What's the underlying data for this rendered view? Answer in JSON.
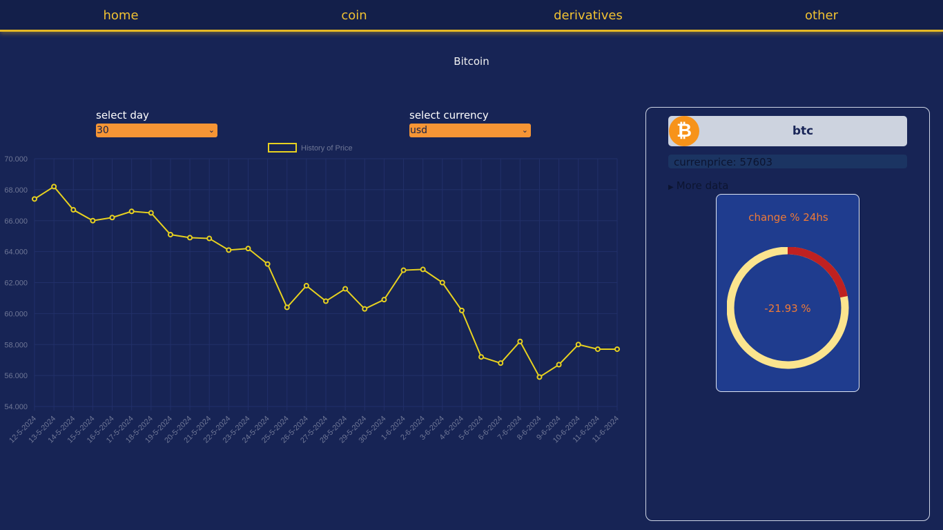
{
  "nav": {
    "items": [
      {
        "label": "home"
      },
      {
        "label": "coin"
      },
      {
        "label": "derivatives"
      },
      {
        "label": "other"
      }
    ]
  },
  "page": {
    "title": "Bitcoin"
  },
  "controls": {
    "day_label": "select day",
    "day_value": "30",
    "currency_label": "select currency",
    "currency_value": "usd"
  },
  "chart_data": {
    "type": "line",
    "x": [
      "12-5-2024",
      "13-5-2024",
      "14-5-2024",
      "15-5-2024",
      "16-5-2024",
      "17-5-2024",
      "18-5-2024",
      "19-5-2024",
      "20-5-2024",
      "21-5-2024",
      "22-5-2024",
      "23-5-2024",
      "24-5-2024",
      "25-5-2024",
      "26-5-2024",
      "27-5-2024",
      "28-5-2024",
      "29-5-2024",
      "30-5-2024",
      "1-6-2024",
      "2-6-2024",
      "3-6-2024",
      "4-6-2024",
      "5-6-2024",
      "6-6-2024",
      "7-6-2024",
      "8-6-2024",
      "9-6-2024",
      "10-6-2024",
      "11-6-2024",
      "11-6-2024"
    ],
    "series": [
      {
        "name": "History of Price",
        "color": "#e8d21f",
        "values": [
          67400,
          68200,
          66700,
          66000,
          66200,
          66600,
          66500,
          65100,
          64900,
          64850,
          64100,
          64200,
          63200,
          60400,
          61800,
          60800,
          61600,
          60300,
          60900,
          62800,
          62850,
          62000,
          60200,
          57200,
          56800,
          58200,
          55900,
          56700,
          58000,
          57700,
          57700
        ]
      }
    ],
    "yticks": [
      "70.000",
      "68.000",
      "66.000",
      "64.000",
      "62.000",
      "60.000",
      "58.000",
      "56.000",
      "54.000"
    ],
    "ylim": [
      54000,
      70000
    ],
    "grid": true,
    "legend": "top-center"
  },
  "coin": {
    "symbol": "btc",
    "logo_icon": "bitcoin-icon",
    "price_text": "currenprice: 57603",
    "more_data_label": "More data",
    "change_title": "change % 24hs",
    "change_text": "-21.93 %",
    "change_value": -21.93,
    "ring_colors": {
      "negative": "#bf2121",
      "rest": "#fbe48e"
    }
  }
}
